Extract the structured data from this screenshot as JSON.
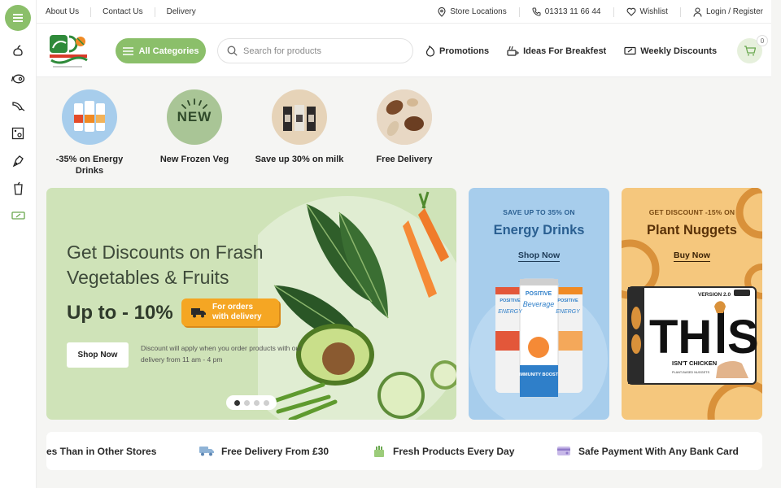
{
  "topbar": {
    "left_links": [
      "About Us",
      "Contact Us",
      "Delivery"
    ],
    "store_locations": "Store Locations",
    "phone": "01313 11 66 44",
    "wishlist": "Wishlist",
    "login": "Login / Register"
  },
  "header": {
    "all_categories": "All Categories",
    "search_placeholder": "Search for products",
    "nav": [
      {
        "label": "Promotions",
        "icon": "flame-icon"
      },
      {
        "label": "Ideas For Breakfest",
        "icon": "breakfast-icon"
      },
      {
        "label": "Weekly Discounts",
        "icon": "ticket-icon"
      }
    ],
    "cart_count": "0"
  },
  "sidebar_icons": [
    "menu-icon",
    "vegetables-icon",
    "meat-icon",
    "seafood-icon",
    "grocery-icon",
    "dairy-icon",
    "drinks-icon",
    "discount-icon"
  ],
  "categories": [
    {
      "label": "-35% on Energy Drinks"
    },
    {
      "label": "New Frozen Veg",
      "badge": "NEW"
    },
    {
      "label": "Save up 30% on milk"
    },
    {
      "label": "Free Delivery"
    }
  ],
  "hero": {
    "title": "Get Discounts on Frash Vegetables & Fruits",
    "up_to": "Up to - 10%",
    "pill": "For orders with delivery",
    "shop_now": "Shop Now",
    "note": "Discount will apply when you order products with our delivery from 11 am - 4 pm",
    "slides": 4,
    "active_slide": 1
  },
  "side_banners": [
    {
      "kicker": "SAVE UP TO 35% ON",
      "title": "Energy Drinks",
      "button": "Shop Now",
      "can_texts": [
        "POSITIVE",
        "Beverage",
        "IMMUNITY BOOST",
        "ENERGY"
      ]
    },
    {
      "kicker": "GET DISCOUNT -15% ON",
      "title": "Plant Nuggets",
      "button": "Buy Now",
      "pack_texts": [
        "VERSION 2.0",
        "TH",
        "S",
        "ISN'T CHICKEN",
        "PLANT-BASED NUGGETS"
      ]
    }
  ],
  "features": [
    {
      "label": "es Than in Other Stores",
      "icon": ""
    },
    {
      "label": "Free Delivery From £30",
      "icon": "truck-icon"
    },
    {
      "label": "Fresh Products Every Day",
      "icon": "produce-icon"
    },
    {
      "label": "Safe Payment With Any Bank Card",
      "icon": "card-icon"
    }
  ],
  "colors": {
    "accent_green": "#8bbf6a",
    "hero_bg": "#cfe3b8",
    "energy_bg": "#a7cdec",
    "nuggets_bg": "#f5c77d",
    "pill_orange": "#f5a623"
  }
}
